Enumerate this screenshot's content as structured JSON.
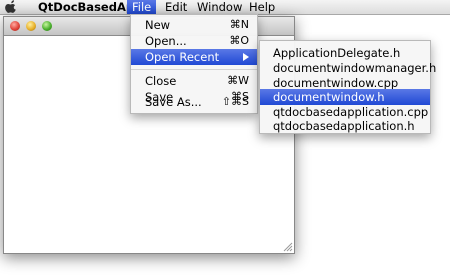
{
  "menubar": {
    "app_name": "QtDocBasedApp",
    "items": [
      "File",
      "Edit",
      "Window",
      "Help"
    ]
  },
  "file_menu": {
    "items": [
      {
        "label": "New",
        "shortcut": "⌘N"
      },
      {
        "label": "Open...",
        "shortcut": "⌘O"
      },
      {
        "label": "Open Recent",
        "shortcut": ""
      },
      {
        "label": "Close",
        "shortcut": "⌘W"
      },
      {
        "label": "Save",
        "shortcut": "⌘S"
      },
      {
        "label": "Save As...",
        "shortcut": "⇧⌘S"
      }
    ]
  },
  "recent_menu": {
    "items": [
      "ApplicationDelegate.h",
      "documentwindowmanager.h",
      "documentwindow.cpp",
      "documentwindow.h",
      "qtdocbasedapplication.cpp",
      "qtdocbasedapplication.h"
    ]
  },
  "colors": {
    "highlight": "#2a52d8",
    "menubar": "#e6e6e6",
    "close_light": "#e0443a",
    "minimize_light": "#e8b02a",
    "zoom_light": "#4bb02e"
  }
}
